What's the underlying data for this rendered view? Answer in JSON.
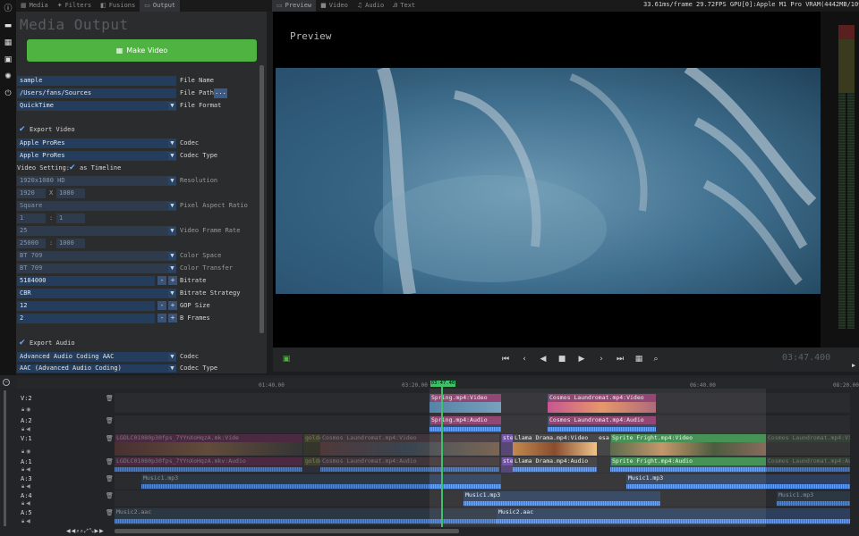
{
  "rail_icons": [
    "info-icon",
    "folder-icon",
    "calendar-icon",
    "save-icon",
    "settings-icon",
    "power-icon"
  ],
  "left_tabs": [
    {
      "label": "Media",
      "icon": "grid-icon"
    },
    {
      "label": "Filters",
      "icon": "wand-icon"
    },
    {
      "label": "Fusions",
      "icon": "fusion-icon"
    },
    {
      "label": "Output",
      "icon": "output-icon",
      "active": true
    }
  ],
  "right_tabs": [
    {
      "label": "Preview",
      "icon": "monitor-icon",
      "active": true
    },
    {
      "label": "Video",
      "icon": "video-icon"
    },
    {
      "label": "Audio",
      "icon": "music-icon"
    },
    {
      "label": "Text",
      "icon": "text-icon"
    }
  ],
  "stats": "33.61ms/frame 29.72FPS GPU[0]:Apple M1 Pro VRAM(4442MB/10922MB)",
  "output": {
    "title": "Media Output",
    "make_button": "Make Video",
    "file_name": {
      "value": "sample",
      "label": "File Name"
    },
    "file_path": {
      "value": "/Users/fans/Sources",
      "label": "File Path",
      "button": "..."
    },
    "file_format": {
      "value": "QuickTime",
      "label": "File Format"
    },
    "export_video": "Export Video",
    "video_codec": {
      "value": "Apple ProRes",
      "label": "Codec"
    },
    "codec_type": {
      "value": "Apple ProRes",
      "label": "Codec Type"
    },
    "video_setting": {
      "label": "Video Setting:",
      "check": "as Timeline"
    },
    "resolution": {
      "value": "1920x1080 HD",
      "label": "Resolution",
      "w": "1920",
      "x": "X",
      "h": "1080"
    },
    "pixel_aspect": {
      "value": "Square",
      "label": "Pixel Aspect Ratio",
      "a": "1",
      "sep": ":",
      "b": "1"
    },
    "frame_rate": {
      "value": "25",
      "label": "Video Frame Rate",
      "a": "25000",
      "sep": ":",
      "b": "1000"
    },
    "color_space": {
      "value": "BT 709",
      "label": "Color Space"
    },
    "color_transfer": {
      "value": "BT 709",
      "label": "Color Transfer"
    },
    "bitrate": {
      "value": "5184000",
      "label": "Bitrate"
    },
    "bitrate_strategy": {
      "value": "CBR",
      "label": "Bitrate Strategy"
    },
    "gop": {
      "value": "12",
      "label": "GOP Size"
    },
    "bframes": {
      "value": "2",
      "label": "B Frames"
    },
    "export_audio": "Export Audio",
    "audio_codec": {
      "value": "Advanced Audio Coding AAC",
      "label": "Codec"
    },
    "audio_codec_type": {
      "value": "AAC (Advanced Audio Coding)",
      "label": "Codec Type"
    },
    "minus": "-",
    "plus": "+"
  },
  "preview": {
    "title": "Preview",
    "timecode": "03:47.400"
  },
  "timeline": {
    "ticks": [
      "01:40.00",
      "03:20.00",
      "06:40.00",
      "08:20.00"
    ],
    "playhead": "03:47.40",
    "tracks": [
      "V:2",
      "A:2",
      "V:1",
      "A:1",
      "A:3",
      "A:4",
      "A:5"
    ],
    "clips": {
      "v2a": "Spring.mp4:Video",
      "v2b": "Cosmos Laundromat.mp4:Video",
      "a2a": "Spring.mp4:Audio",
      "a2b": "Cosmos Laundromat.mp4:Audio",
      "v1a": "LGDLC01080p30fps_7YYnXoHqzA.mk:Vide",
      "v1b": "golde",
      "v1c": "Cosmos Laundromat.mp4:Video",
      "v1d": "ste",
      "v1e": "Llama Drama.mp4:Video",
      "v1f": "esa",
      "v1g": "Sprite Fright.mp4:Video",
      "v1h": "Cosmos Laundromat.mp4:Vi",
      "a1a": "LGDLC01080p30fps_7YYnXoHqzA.mkv:Audio",
      "a1b": "golde",
      "a1c": "Cosmos Laundromat.mp4:Audio",
      "a1d": "ste",
      "a1e": "Llama Drama.mp4:Audio",
      "a1f": "Sprite Fright.mp4:Audio",
      "a1g": "Cosmos Laundromat.mp4:Au",
      "a3a": "Music1.mp3",
      "a3b": "Music1.mp3",
      "a4a": "Music1.mp3",
      "a4b": "Music1.mp3",
      "a5a": "Music2.aac",
      "a5b": "Music2.aac"
    }
  },
  "colors": {
    "accent": "#4fb341",
    "field": "#243d5c",
    "playhead": "#3fc16a",
    "video_clip": "#8a3a6a",
    "audio_clip": "#3d5a7a"
  }
}
